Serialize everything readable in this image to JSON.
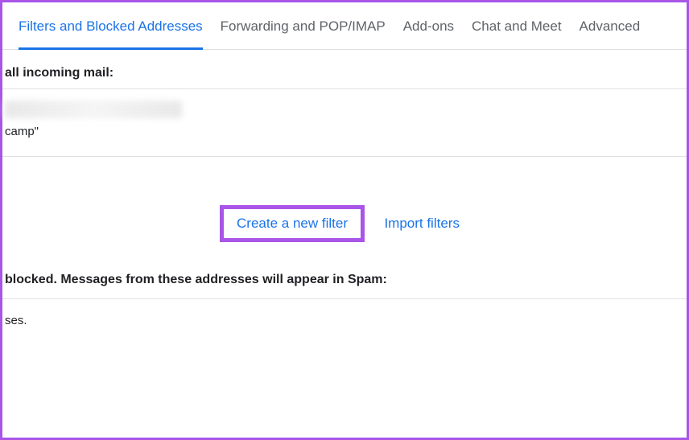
{
  "tabs": {
    "filters": "Filters and Blocked Addresses",
    "forwarding": "Forwarding and POP/IMAP",
    "addons": "Add-ons",
    "chat": "Chat and Meet",
    "advanced": "Advanced"
  },
  "sections": {
    "filters_label": "all incoming mail:",
    "filter_snippet": "camp\"",
    "blocked_label": "blocked. Messages from these addresses will appear in Spam:",
    "blocked_text": "ses."
  },
  "actions": {
    "create_filter": "Create a new filter",
    "import_filters": "Import filters"
  }
}
